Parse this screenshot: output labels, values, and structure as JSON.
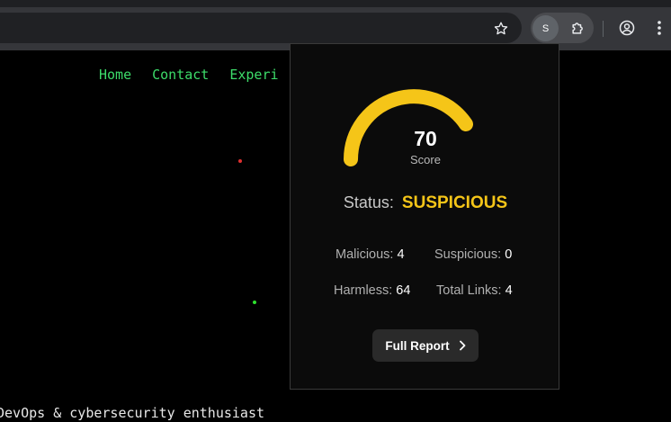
{
  "browser": {
    "extension_badge": "S",
    "icons": [
      "star-icon",
      "puzzle-icon",
      "profile-icon",
      "kebab-menu-icon"
    ]
  },
  "page": {
    "nav": [
      "Home",
      "Contact",
      "Experi"
    ],
    "tagline": "DevOps & cybersecurity enthusiast"
  },
  "popup": {
    "score": "70",
    "score_label": "Score",
    "score_fraction": 0.7,
    "status_label": "Status:",
    "status_value": "SUSPICIOUS",
    "stats": {
      "malicious_label": "Malicious:",
      "malicious": "4",
      "suspicious_label": "Suspicious:",
      "suspicious": "0",
      "harmless_label": "Harmless:",
      "harmless": "64",
      "total_label": "Total Links:",
      "total": "4"
    },
    "report_button": "Full Report",
    "colors": {
      "accent": "#f5c518",
      "nav_green": "#3ddc6a"
    }
  }
}
